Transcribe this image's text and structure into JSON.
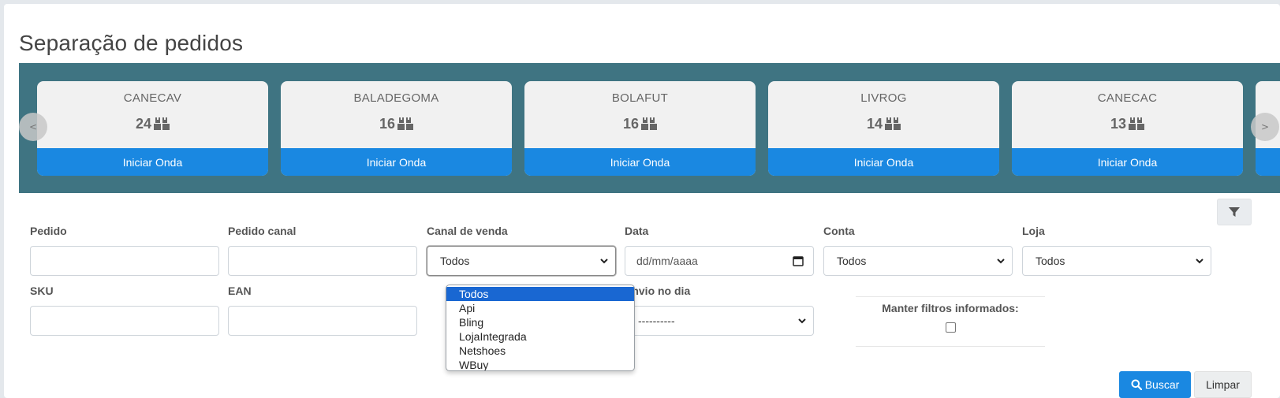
{
  "page": {
    "title": "Separação de pedidos"
  },
  "carousel": {
    "prev_label": "<",
    "next_label": ">",
    "cards": [
      {
        "code": "CANECAV",
        "count": "24",
        "button": "Iniciar Onda"
      },
      {
        "code": "BALADEGOMA",
        "count": "16",
        "button": "Iniciar Onda"
      },
      {
        "code": "BOLAFUT",
        "count": "16",
        "button": "Iniciar Onda"
      },
      {
        "code": "LIVROG",
        "count": "14",
        "button": "Iniciar Onda"
      },
      {
        "code": "CANECAC",
        "count": "13",
        "button": "Iniciar Onda"
      }
    ]
  },
  "filters": {
    "pedido": {
      "label": "Pedido",
      "value": ""
    },
    "pedido_canal": {
      "label": "Pedido canal",
      "value": ""
    },
    "canal_venda": {
      "label": "Canal de venda",
      "value": "Todos"
    },
    "data": {
      "label": "Data",
      "placeholder": "dd/mm/aaaa"
    },
    "conta": {
      "label": "Conta",
      "value": "Todos"
    },
    "loja": {
      "label": "Loja",
      "value": "Todos"
    },
    "sku": {
      "label": "SKU",
      "value": ""
    },
    "ean": {
      "label": "EAN",
      "value": ""
    },
    "envio_dia": {
      "label": "Envio no dia",
      "value": "----------"
    },
    "manter_filtros": {
      "label": "Manter filtros informados:",
      "checked": false
    }
  },
  "dropdown": {
    "options": [
      "Todos",
      "Api",
      "Bling",
      "LojaIntegrada",
      "Netshoes",
      "WBuy"
    ],
    "selected": "Todos"
  },
  "actions": {
    "search_label": "Buscar",
    "clear_label": "Limpar"
  },
  "colors": {
    "accent": "#1a88e1",
    "carousel_bg": "#3f7482",
    "card_bg": "#f1f1f1"
  }
}
